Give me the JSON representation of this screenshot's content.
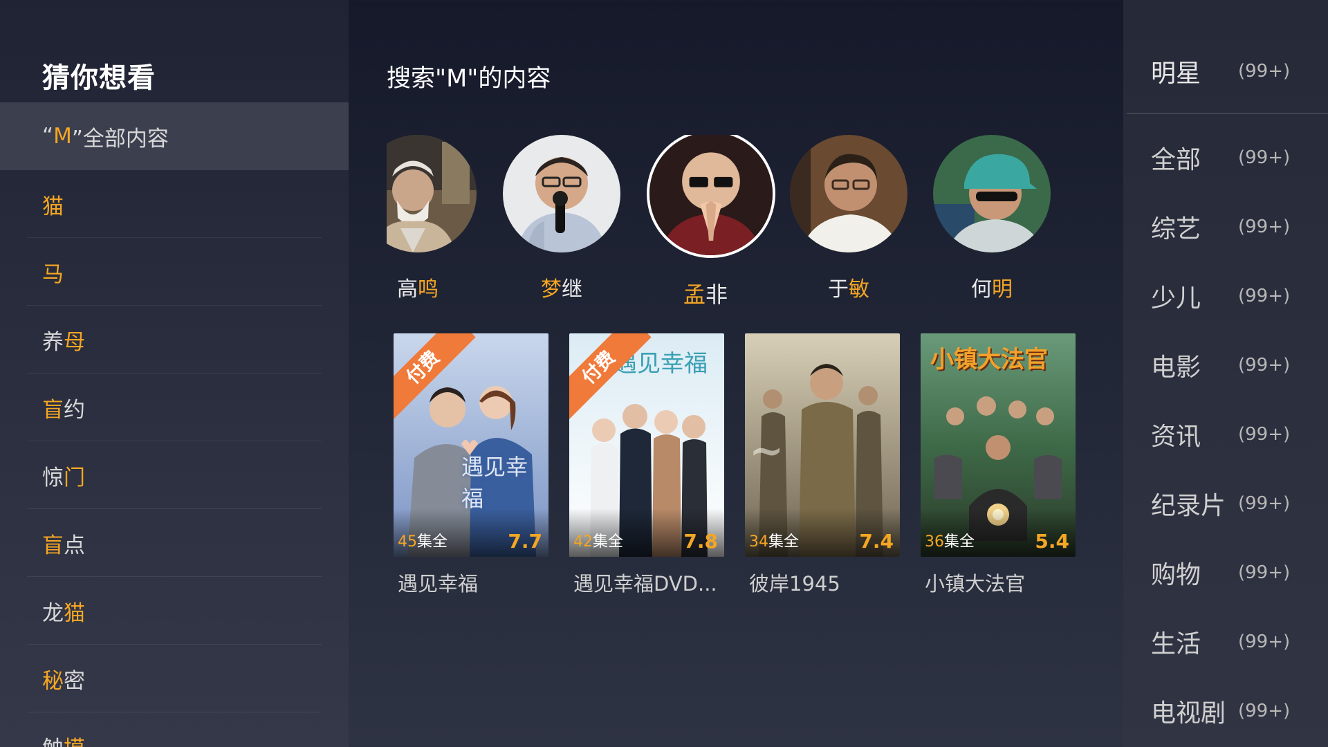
{
  "left": {
    "title": "猜你想看",
    "items": [
      {
        "parts": [
          {
            "t": "“",
            "h": false
          },
          {
            "t": "M",
            "h": true
          },
          {
            "t": "”全部内容",
            "h": false
          }
        ],
        "active": true
      },
      {
        "parts": [
          {
            "t": "猫",
            "h": true
          }
        ]
      },
      {
        "parts": [
          {
            "t": "马",
            "h": true
          }
        ]
      },
      {
        "parts": [
          {
            "t": "养",
            "h": false
          },
          {
            "t": "母",
            "h": true
          }
        ]
      },
      {
        "parts": [
          {
            "t": "盲",
            "h": true
          },
          {
            "t": "约",
            "h": false
          }
        ]
      },
      {
        "parts": [
          {
            "t": "惊",
            "h": false
          },
          {
            "t": "门",
            "h": true
          }
        ]
      },
      {
        "parts": [
          {
            "t": "盲",
            "h": true
          },
          {
            "t": "点",
            "h": false
          }
        ]
      },
      {
        "parts": [
          {
            "t": "龙",
            "h": false
          },
          {
            "t": "猫",
            "h": true
          }
        ]
      },
      {
        "parts": [
          {
            "t": "秘",
            "h": true
          },
          {
            "t": "密",
            "h": false
          }
        ]
      },
      {
        "parts": [
          {
            "t": "触",
            "h": false
          },
          {
            "t": "摸",
            "h": true
          }
        ]
      }
    ]
  },
  "center": {
    "title": "搜索\"M\"的内容",
    "celebs": [
      {
        "name_a": "高",
        "name_b": "鸣",
        "hl": "b"
      },
      {
        "name_a": "梦",
        "name_b": "继",
        "hl": "a"
      },
      {
        "name_a": "孟",
        "name_b": "非",
        "hl": "a",
        "focus": true
      },
      {
        "name_a": "于",
        "name_b": "敏",
        "hl": "b"
      },
      {
        "name_a": "何",
        "name_b": "明",
        "hl": "b"
      }
    ],
    "posters": [
      {
        "title": "遇见幸福",
        "ep_num": "45",
        "ep_text": "集全",
        "score": "7.7",
        "paid": "付费"
      },
      {
        "title": "遇见幸福DVD...",
        "ep_num": "42",
        "ep_text": "集全",
        "score": "7.8",
        "paid": "付费"
      },
      {
        "title": "彼岸1945",
        "ep_num": "34",
        "ep_text": "集全",
        "score": "7.4",
        "paid": ""
      },
      {
        "title": "小镇大法官",
        "ep_num": "36",
        "ep_text": "集全",
        "score": "5.4",
        "paid": ""
      }
    ],
    "poster_overlay_text": [
      "遇见幸福",
      "遇见幸福",
      "小镇大法官"
    ]
  },
  "right": {
    "categories": [
      {
        "label": "明星",
        "count": "(99+)"
      },
      {
        "label": "全部",
        "count": "(99+)"
      },
      {
        "label": "综艺",
        "count": "(99+)"
      },
      {
        "label": "少儿",
        "count": "(99+)"
      },
      {
        "label": "电影",
        "count": "(99+)"
      },
      {
        "label": "资讯",
        "count": "(99+)"
      },
      {
        "label": "纪录片",
        "count": "(99+)"
      },
      {
        "label": "购物",
        "count": "(99+)"
      },
      {
        "label": "生活",
        "count": "(99+)"
      },
      {
        "label": "电视剧",
        "count": "(99+)"
      }
    ]
  },
  "colors": {
    "highlight": "#f5a623",
    "paid_ribbon": "#f07a3a"
  }
}
